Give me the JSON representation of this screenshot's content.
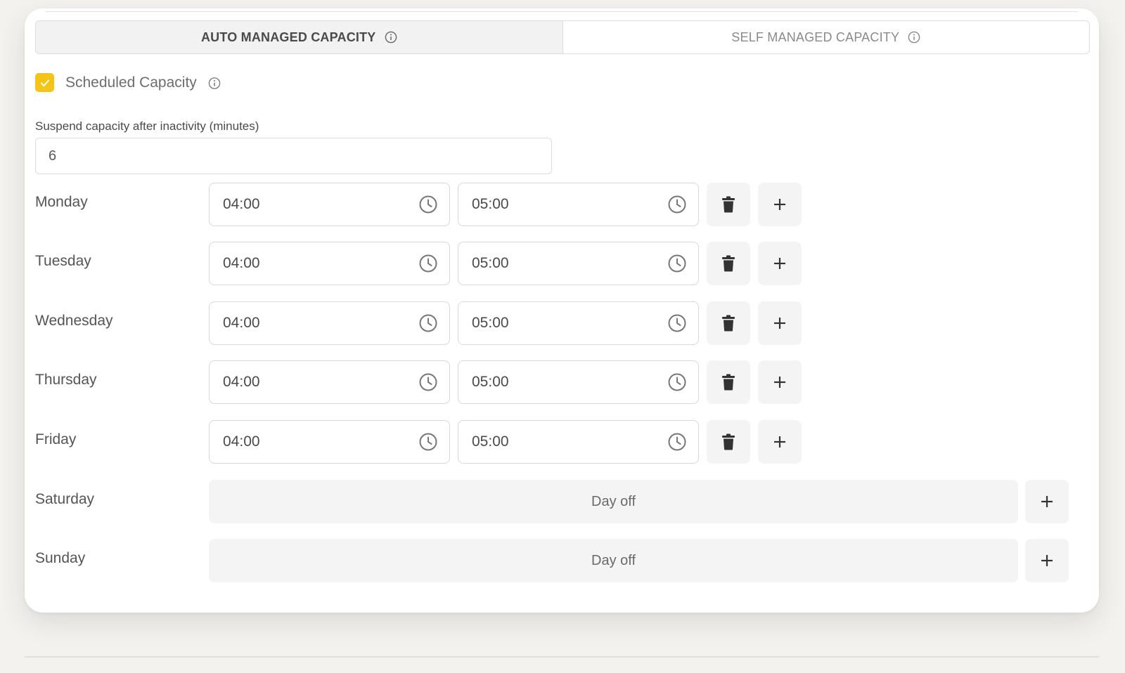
{
  "tabs": [
    {
      "label": "AUTO MANAGED CAPACITY",
      "active": true
    },
    {
      "label": "SELF MANAGED CAPACITY",
      "active": false
    }
  ],
  "scheduled": {
    "label": "Scheduled Capacity",
    "checked": true
  },
  "suspend": {
    "label": "Suspend capacity after inactivity (minutes)",
    "value": "6"
  },
  "days": [
    {
      "name": "Monday",
      "start": "04:00",
      "end": "05:00"
    },
    {
      "name": "Tuesday",
      "start": "04:00",
      "end": "05:00"
    },
    {
      "name": "Wednesday",
      "start": "04:00",
      "end": "05:00"
    },
    {
      "name": "Thursday",
      "start": "04:00",
      "end": "05:00"
    },
    {
      "name": "Friday",
      "start": "04:00",
      "end": "05:00"
    },
    {
      "name": "Saturday",
      "off_label": "Day off"
    },
    {
      "name": "Sunday",
      "off_label": "Day off"
    }
  ],
  "colors": {
    "accent": "#f5c418",
    "button_bg": "#f4f4f4",
    "border": "#dcdcdc"
  },
  "icons": {
    "info": "info-icon",
    "clock": "clock-icon",
    "delete": "trash-icon",
    "add": "plus-icon",
    "check": "check-icon"
  }
}
